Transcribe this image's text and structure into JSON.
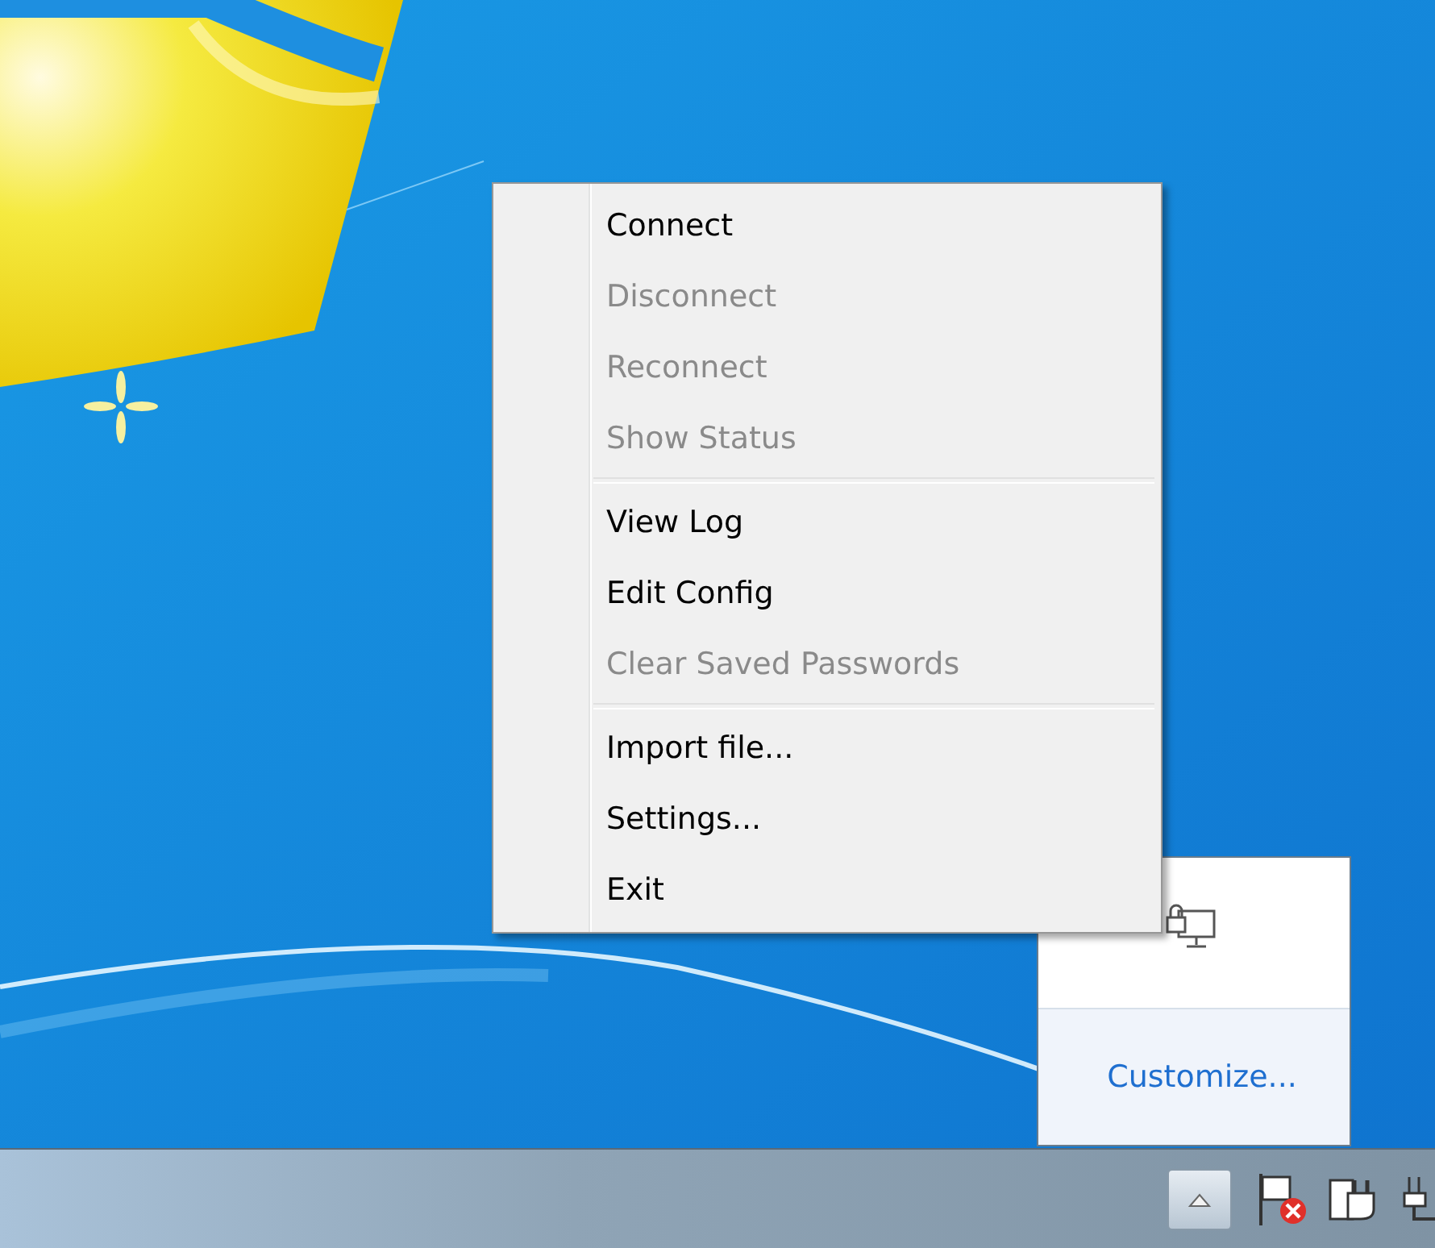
{
  "context_menu": {
    "groups": [
      [
        {
          "label": "Connect",
          "disabled": false
        },
        {
          "label": "Disconnect",
          "disabled": true
        },
        {
          "label": "Reconnect",
          "disabled": true
        },
        {
          "label": "Show Status",
          "disabled": true
        }
      ],
      [
        {
          "label": "View Log",
          "disabled": false
        },
        {
          "label": "Edit Config",
          "disabled": false
        },
        {
          "label": "Clear Saved Passwords",
          "disabled": true
        }
      ],
      [
        {
          "label": "Import file...",
          "disabled": false
        },
        {
          "label": "Settings...",
          "disabled": false
        },
        {
          "label": "Exit",
          "disabled": false
        }
      ]
    ]
  },
  "tray_popup": {
    "link": "Customize..."
  }
}
